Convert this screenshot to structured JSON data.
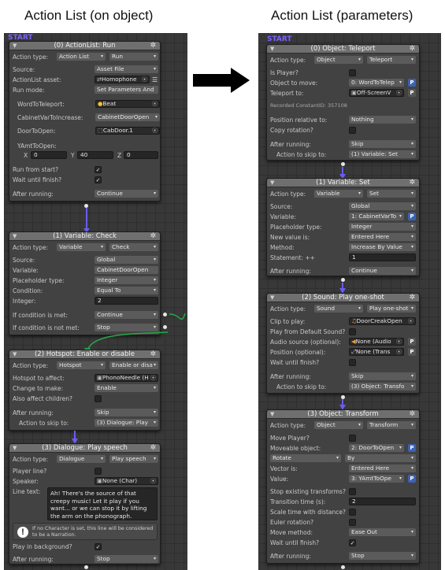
{
  "headings": {
    "left": "Action List (on object)",
    "right": "Action List (parameters)"
  },
  "common": {
    "start": "START",
    "gear": "✲",
    "collapse": "▼",
    "arrow_dd": "▾",
    "check": "✓",
    "target": "⦿",
    "p": "P"
  },
  "left": {
    "n0": {
      "title": "(0) ActionList: Run",
      "action_type_label": "Action type:",
      "action_type": "Action List",
      "action_sub": "Run",
      "source_label": "Source:",
      "source": "Asset File",
      "asset_label": "ActionList asset:",
      "asset": "Homophone",
      "run_mode_label": "Run mode:",
      "run_mode": "Set Parameters And",
      "word_label": "WordToTeleport:",
      "word": "Beat",
      "cabinet_label": "CabinetVarToIncrease:",
      "cabinet": "CabinetDoorOpen",
      "door_label": "DoorToOpen:",
      "door": "CabDoor.1",
      "yamt_label": "YAmtToOpen:",
      "x_label": "X",
      "x_val": "0",
      "y_label": "Y",
      "y_val": "40",
      "z_label": "Z",
      "z_val": "0",
      "run_start_label": "Run from start?",
      "wait_label": "Wait until finish?",
      "after_label": "After running:",
      "after": "Continue"
    },
    "n1": {
      "title": "(1) Variable: Check",
      "action_type_label": "Action type:",
      "action_type": "Variable",
      "action_sub": "Check",
      "source_label": "Source:",
      "source": "Global",
      "variable_label": "Variable:",
      "variable": "CabinetDoorOpen",
      "ph_label": "Placeholder type:",
      "ph": "Integer",
      "cond_label": "Condition:",
      "cond": "Equal To",
      "int_label": "Integer:",
      "int_val": "2",
      "met_label": "If condition is met:",
      "met": "Continue",
      "notmet_label": "If condition is not met:",
      "notmet": "Stop"
    },
    "n2": {
      "title": "(2) Hotspot: Enable or disable",
      "action_type_label": "Action type:",
      "action_type": "Hotspot",
      "action_sub": "Enable or disa",
      "hotspot_label": "Hotspot to affect:",
      "hotspot": "PhonoNeedle (H",
      "change_label": "Change to make:",
      "change": "Enable",
      "children_label": "Also affect children?",
      "after_label": "After running:",
      "after": "Skip",
      "skip_label": "Action to skip to:",
      "skip": "(3) Dialogue: Play"
    },
    "n3": {
      "title": "(3) Dialogue: Play speech",
      "action_type_label": "Action type:",
      "action_type": "Dialogue",
      "action_sub": "Play speech",
      "player_label": "Player line?",
      "speaker_label": "Speaker:",
      "speaker": "None (Char)",
      "line_label": "Line text:",
      "line_text": "Ah! There's the source of that creepy music! Let it play if you want... or we can stop it by lifting the arm on the phonograph.",
      "info": "If no Character is set, this line will be considered to be a Narration.",
      "bg_label": "Play in background?",
      "after_label": "After running:",
      "after": "Stop"
    }
  },
  "right": {
    "n0": {
      "title": "(0) Object: Teleport",
      "action_type_label": "Action type:",
      "action_type": "Object",
      "action_sub": "Teleport",
      "player_label": "Is Player?",
      "move_label": "Object to move:",
      "move": "0: WordToTelep",
      "tele_label": "Teleport to:",
      "tele": "Off-ScreenV",
      "recorded": "Recorded ConstantID: 357108",
      "pos_label": "Position relative to:",
      "pos": "Nothing",
      "copy_label": "Copy rotation?",
      "after_label": "After running:",
      "after": "Skip",
      "skip_label": "Action to skip to:",
      "skip": "(1) Variable: Set"
    },
    "n1": {
      "title": "(1) Variable: Set",
      "action_type_label": "Action type:",
      "action_type": "Variable",
      "action_sub": "Set",
      "source_label": "Source:",
      "source": "Global",
      "variable_label": "Variable:",
      "variable": "1: CabinetVarTo",
      "ph_label": "Placeholder type:",
      "ph": "Integer",
      "new_label": "New value is:",
      "new_val": "Entered Here",
      "method_label": "Method:",
      "method": "Increase By Value",
      "stmt_label": "Statement: ++",
      "stmt": "1",
      "after_label": "After running:",
      "after": "Continue"
    },
    "n2": {
      "title": "(2) Sound: Play one-shot",
      "action_type_label": "Action type:",
      "action_type": "Sound",
      "action_sub": "Play one-shot",
      "clip_label": "Clip to play:",
      "clip": "DoorCreakOpen",
      "default_label": "Play from Default Sound?",
      "audio_label": "Audio source (optional):",
      "audio": "None (Audio",
      "position_label": "Position (optional):",
      "position": "None (Trans",
      "wait_label": "Wait until finish?",
      "after_label": "After running:",
      "after": "Skip",
      "skip_label": "Action to skip to:",
      "skip": "(3) Object: Transfo"
    },
    "n3": {
      "title": "(3) Object: Transform",
      "action_type_label": "Action type:",
      "action_type": "Object",
      "action_sub": "Transform",
      "move_player_label": "Move Player?",
      "moveable_label": "Moveable object:",
      "moveable": "2: DoorToOpen",
      "rotate": "Rotate",
      "by": "By",
      "vector_label": "Vector is:",
      "vector": "Entered Here",
      "value_label": "Value:",
      "value": "3: YAmtToOpe",
      "snap_label": "Stop existing transforms?",
      "time_label": "Transition time (s):",
      "time": "2",
      "scale_label": "Scale time with distance?",
      "euler_label": "Euler rotation?",
      "method_label": "Move method:",
      "method": "Ease Out",
      "wait_label": "Wait until finish?",
      "after_label": "After running:",
      "after": "Stop"
    }
  }
}
